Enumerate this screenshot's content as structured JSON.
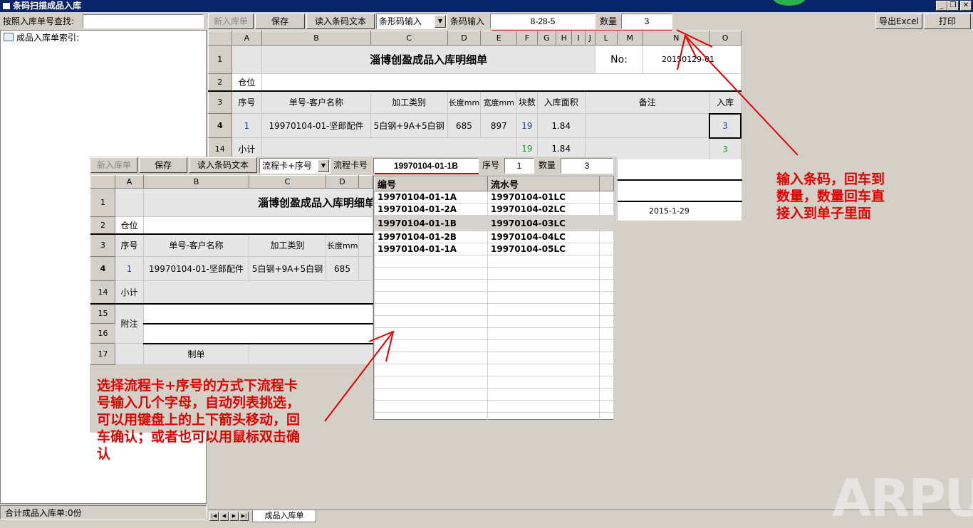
{
  "window": {
    "title": "条码扫描成品入库",
    "buttons": [
      "_",
      "❐",
      "✕"
    ]
  },
  "left": {
    "search_label": "按照入库单号查找:",
    "search_value": "",
    "tree_root": "成品入库单索引:",
    "footer": "合计成品入库单:0份"
  },
  "toolbar": {
    "new_label": "新入库单",
    "save_label": "保存",
    "read_label": "读入条码文本",
    "mode_value": "条形码输入",
    "barcode_label": "条码输入",
    "barcode_value": "8-28-5",
    "qty_label": "数量",
    "qty_value": "3",
    "export_label": "导出Excel",
    "print_label": "打印"
  },
  "sheet": {
    "col_headers": [
      "A",
      "B",
      "C",
      "D",
      "E",
      "F",
      "G",
      "H",
      "I",
      "J",
      "L",
      "M",
      "N",
      "O"
    ],
    "title": "淄博创盈成品入库明细单",
    "no_label": "No:",
    "no_value": "20150129-01",
    "warehouse_label": "仓位",
    "headers": {
      "seq": "序号",
      "order": "单号-客户名称",
      "process": "加工类别",
      "length": "长度mm",
      "width": "宽度mm",
      "pieces": "块数",
      "area": "入库面积",
      "remark": "备注",
      "in": "入库"
    },
    "row": {
      "num": "4",
      "seq": "1",
      "order": "19970104-01-坚郎配件",
      "process": "5白钢+9A+5白钢",
      "length": "685",
      "width": "897",
      "pieces": "19",
      "area": "1.84",
      "in": "3"
    },
    "subtotal": {
      "num": "14",
      "label": "小计",
      "pieces": "19",
      "area": "1.84",
      "in": "3"
    },
    "row_nums": [
      "1",
      "2",
      "3"
    ],
    "date": "2015-1-29"
  },
  "overlay": {
    "new_label": "新入库单",
    "save_label": "保存",
    "read_label": "读入条码文本",
    "mode_value": "流程卡+序号",
    "card_label": "流程卡号",
    "card_value": "19970104-01-1B",
    "seq_label": "序号",
    "seq_value": "1",
    "qty_label": "数量",
    "qty_value": "3",
    "col_headers": [
      "A",
      "B",
      "C",
      "D"
    ],
    "title": "淄博创盈成品入库明细单",
    "warehouse_label": "仓位",
    "headers": {
      "seq": "序号",
      "order": "单号-客户名称",
      "process": "加工类别",
      "length": "长度mm"
    },
    "row": {
      "num": "4",
      "seq": "1",
      "order": "19970104-01-坚郎配件",
      "process": "5白钢+9A+5白钢",
      "length": "685"
    },
    "subtotal": {
      "num": "14",
      "label": "小计"
    },
    "notes_label": "附注",
    "maker_label": "制单",
    "row_nums": [
      "1",
      "2",
      "3",
      "15",
      "16",
      "17"
    ]
  },
  "dropdown": {
    "headers": [
      "编号",
      "流水号"
    ],
    "rows": [
      [
        "19970104-01-1A",
        "19970104-01LC"
      ],
      [
        "19970104-01-2A",
        "19970104-02LC"
      ],
      [
        "19970104-01-1B",
        "19970104-03LC"
      ],
      [
        "19970104-01-2B",
        "19970104-04LC"
      ],
      [
        "19970104-01-1A",
        "19970104-05LC"
      ]
    ],
    "selected_index": 2
  },
  "tabs": {
    "sheet_tab": "成品入库单"
  },
  "annotations": {
    "right_note": "输入条码，回车到数量，数量回车直接入到单子里面",
    "left_note": "选择流程卡+序号的方式下流程卡号输入几个字母，自动列表挑选，可以用键盘上的上下箭头移动，回车确认；或者也可以用鼠标双击确认",
    "watermark": "ARPUN"
  },
  "colors": {
    "accent_red": "#e00000",
    "title_bar": "#0a246a",
    "pieces_green": "#1a9a2a",
    "seq_blue": "#1a3fc0"
  }
}
